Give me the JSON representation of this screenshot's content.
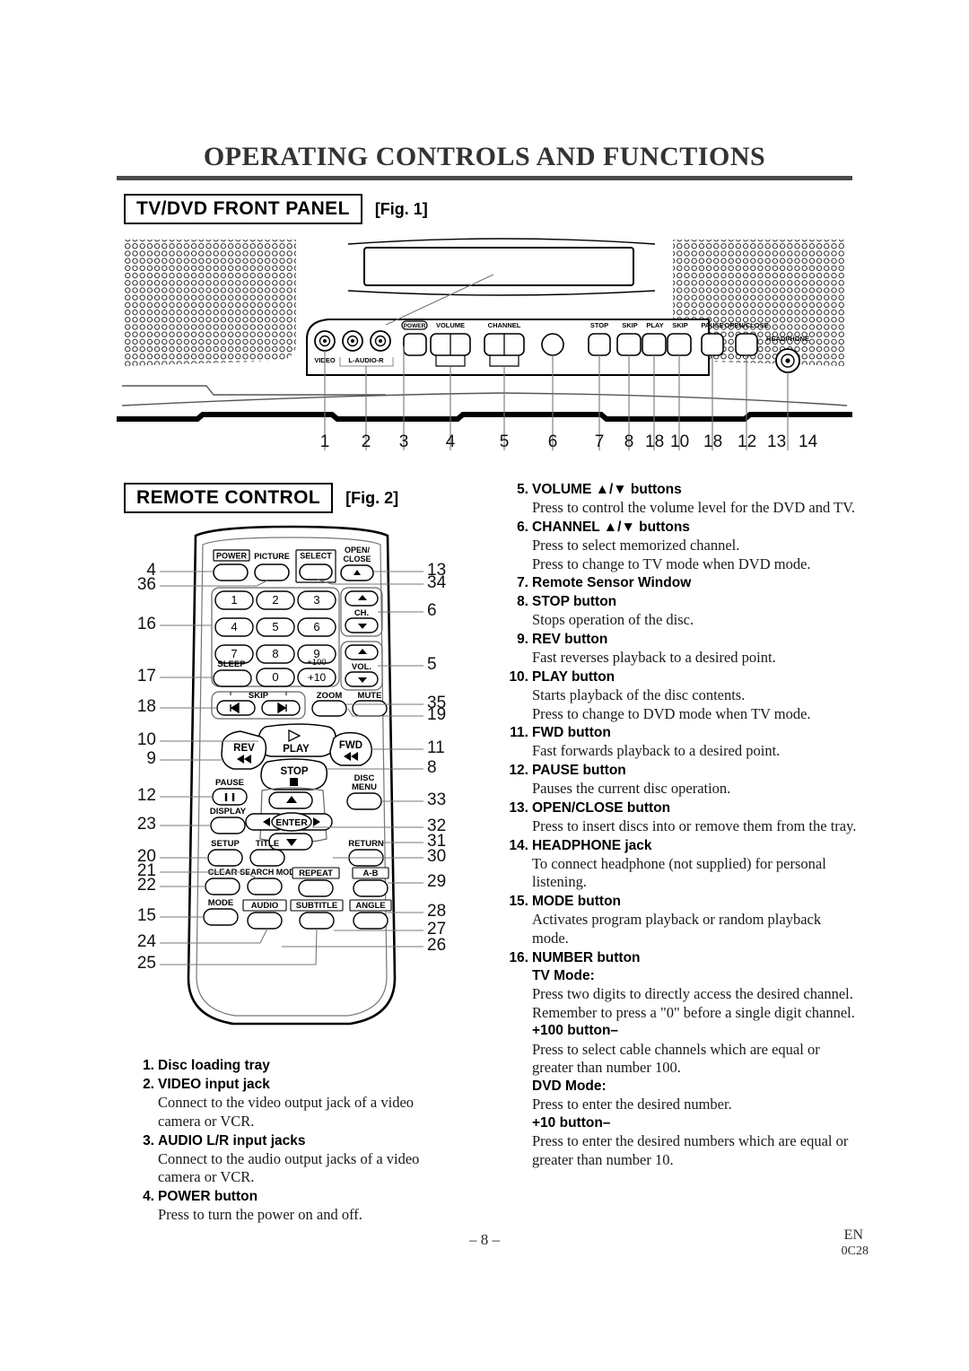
{
  "document": {
    "title": "OPERATING CONTROLS AND FUNCTIONS",
    "page_number": "– 8 –",
    "footer_lang": "EN",
    "footer_code": "0C28"
  },
  "sections": {
    "front_panel": {
      "heading": "TV/DVD FRONT PANEL",
      "figure": "[Fig. 1]"
    },
    "remote": {
      "heading": "REMOTE CONTROL",
      "figure": "[Fig. 2]"
    }
  },
  "front_panel_figure": {
    "jack_labels": [
      "VIDEO",
      "L-AUDIO-R"
    ],
    "button_labels": [
      "POWER",
      "VOLUME",
      "CHANNEL",
      "STOP",
      "SKIP",
      "PLAY",
      "SKIP",
      "PAUSE",
      "OPEN/CLOSE",
      "HEADPHONE"
    ],
    "callouts": [
      "1",
      "2",
      "3",
      "4",
      "5",
      "6",
      "7",
      "8",
      "18",
      "10",
      "18",
      "12",
      "13",
      "14"
    ]
  },
  "remote_figure": {
    "callouts_left": [
      "4",
      "36",
      "16",
      "17",
      "18",
      "10",
      "9",
      "12",
      "23",
      "20",
      "21",
      "22",
      "15",
      "24",
      "25"
    ],
    "callouts_right": [
      "13",
      "34",
      "6",
      "5",
      "35",
      "19",
      "11",
      "8",
      "33",
      "32",
      "31",
      "30",
      "29",
      "28",
      "27",
      "26"
    ],
    "buttons": {
      "row_top": [
        "POWER",
        "PICTURE",
        "SELECT",
        "OPEN/ CLOSE"
      ],
      "keypad": [
        "1",
        "2",
        "3",
        "4",
        "5",
        "6",
        "7",
        "8",
        "9",
        "0",
        "+10"
      ],
      "keypad_extra": [
        "+100",
        "SLEEP"
      ],
      "side_pads": [
        "CH.",
        "VOL."
      ],
      "skip": "SKIP",
      "zoom": "ZOOM",
      "mute": "MUTE",
      "transport": [
        "PLAY",
        "REV",
        "FWD",
        "STOP"
      ],
      "pause": "PAUSE",
      "display": "DISPLAY",
      "disc_menu": "DISC MENU",
      "enter": "ENTER",
      "row_setup": [
        "SETUP",
        "TITLE",
        "RETURN"
      ],
      "row_clear": [
        "CLEAR",
        "SEARCH MODE",
        "REPEAT",
        "A-B"
      ],
      "row_mode": [
        "MODE",
        "AUDIO",
        "SUBTITLE",
        "ANGLE"
      ]
    }
  },
  "left_column": [
    {
      "num": "1.",
      "label": "Disc loading tray",
      "body": []
    },
    {
      "num": "2.",
      "label": "VIDEO input jack",
      "body": [
        "Connect to the video output jack of a video camera or VCR."
      ]
    },
    {
      "num": "3.",
      "label": "AUDIO L/R input jacks",
      "body": [
        "Connect to the audio output jacks of a video camera or VCR."
      ]
    },
    {
      "num": "4.",
      "label": "POWER button",
      "body": [
        "Press to turn the power on and off."
      ]
    }
  ],
  "right_column": [
    {
      "num": "5.",
      "label": "VOLUME ▲/▼ buttons",
      "body": [
        "Press to control the volume level for the DVD and TV."
      ]
    },
    {
      "num": "6.",
      "label": "CHANNEL ▲/▼ buttons",
      "body": [
        "Press to select memorized channel.",
        "Press to change to TV mode when DVD mode."
      ]
    },
    {
      "num": "7.",
      "label": "Remote Sensor Window",
      "body": []
    },
    {
      "num": "8.",
      "label": "STOP button",
      "body": [
        "Stops operation of the disc."
      ]
    },
    {
      "num": "9.",
      "label": "REV button",
      "body": [
        "Fast reverses playback to a desired point."
      ]
    },
    {
      "num": "10.",
      "label": "PLAY button",
      "body": [
        "Starts playback of the disc contents.",
        "Press to change to DVD mode when TV mode."
      ]
    },
    {
      "num": "11.",
      "label": "FWD button",
      "body": [
        "Fast forwards playback to a desired point."
      ]
    },
    {
      "num": "12.",
      "label": "PAUSE button",
      "body": [
        "Pauses the current disc operation."
      ]
    },
    {
      "num": "13.",
      "label": "OPEN/CLOSE button",
      "body": [
        "Press to insert discs into or remove them from the tray."
      ]
    },
    {
      "num": "14.",
      "label": "HEADPHONE jack",
      "body": [
        "To connect headphone (not supplied) for personal listening."
      ]
    },
    {
      "num": "15.",
      "label": "MODE button",
      "body": [
        "Activates program playback or random playback mode."
      ]
    },
    {
      "num": "16.",
      "label": "NUMBER button",
      "body": [],
      "subs": [
        {
          "head": "TV Mode:",
          "body": [
            "Press two digits to directly access the desired channel.",
            "Remember to press a \"0\" before a single digit channel."
          ]
        },
        {
          "head": "+100 button–",
          "body": [
            "Press to select cable channels which are equal or greater than number 100."
          ]
        },
        {
          "head": "DVD Mode:",
          "body": [
            "Press to enter the desired number."
          ]
        },
        {
          "head": "+10 button–",
          "body": [
            "Press to enter the desired numbers which are equal or greater than number 10."
          ]
        }
      ]
    }
  ]
}
